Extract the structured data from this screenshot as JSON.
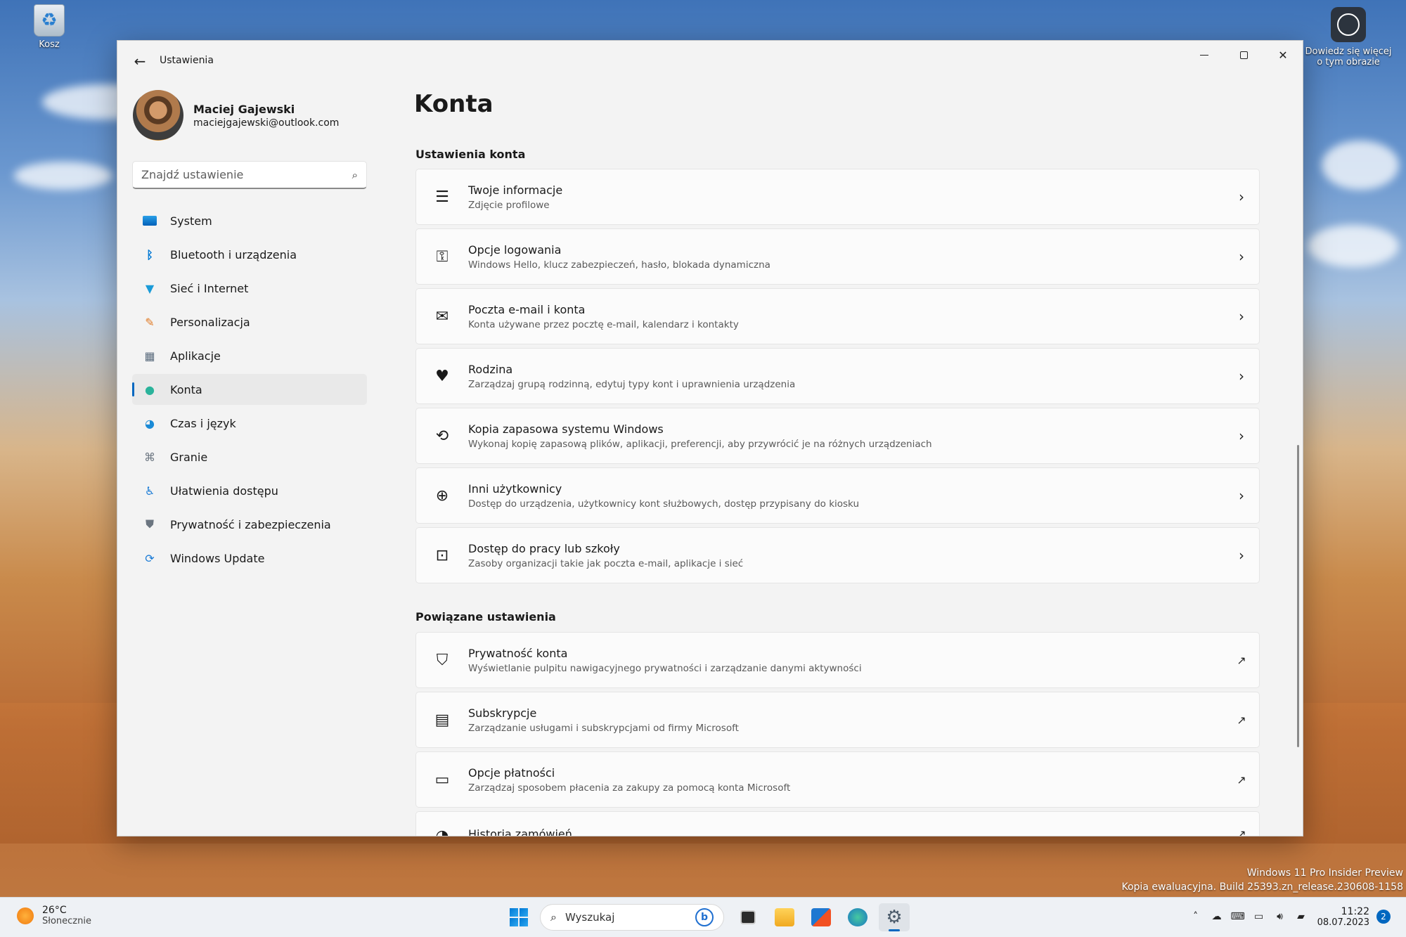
{
  "desktop": {
    "recycle_label": "Kosz",
    "learn_label_line1": "Dowiedz się więcej",
    "learn_label_line2": "o tym obrazie",
    "watermark_line1": "Windows 11 Pro Insider Preview",
    "watermark_line2": "Kopia ewaluacyjna. Build 25393.zn_release.230608-1158"
  },
  "window": {
    "app_title": "Ustawienia",
    "profile": {
      "name": "Maciej Gajewski",
      "email": "maciejgajewski@outlook.com"
    },
    "search": {
      "placeholder": "Znajdź ustawienie"
    },
    "nav": [
      {
        "label": "System",
        "icon": "monitor-icon",
        "color": "#0078d4"
      },
      {
        "label": "Bluetooth i urządzenia",
        "icon": "bluetooth-icon",
        "color": "#0078d4"
      },
      {
        "label": "Sieć i Internet",
        "icon": "wifi-icon",
        "color": "#1a9bd8"
      },
      {
        "label": "Personalizacja",
        "icon": "brush-icon",
        "color": "#e07b26"
      },
      {
        "label": "Aplikacje",
        "icon": "apps-icon",
        "color": "#5a6b7d"
      },
      {
        "label": "Konta",
        "icon": "person-icon",
        "color": "#2bb39b",
        "active": true
      },
      {
        "label": "Czas i język",
        "icon": "globe-clock-icon",
        "color": "#1a8ad6"
      },
      {
        "label": "Granie",
        "icon": "gamepad-icon",
        "color": "#6b7580"
      },
      {
        "label": "Ułatwienia dostępu",
        "icon": "accessibility-icon",
        "color": "#1a7bd6"
      },
      {
        "label": "Prywatność i zabezpieczenia",
        "icon": "shield-icon",
        "color": "#6b7580"
      },
      {
        "label": "Windows Update",
        "icon": "refresh-icon",
        "color": "#1a7bd6"
      }
    ],
    "page_title": "Konta",
    "section_account": "Ustawienia konta",
    "account_cards": [
      {
        "title": "Twoje informacje",
        "sub": "Zdjęcie profilowe",
        "icon": "person-list-icon"
      },
      {
        "title": "Opcje logowania",
        "sub": "Windows Hello, klucz zabezpieczeń, hasło, blokada dynamiczna",
        "icon": "key-icon"
      },
      {
        "title": "Poczta e-mail i konta",
        "sub": "Konta używane przez pocztę e-mail, kalendarz i kontakty",
        "icon": "mail-icon"
      },
      {
        "title": "Rodzina",
        "sub": "Zarządzaj grupą rodzinną, edytuj typy kont i uprawnienia urządzenia",
        "icon": "family-heart-icon"
      },
      {
        "title": "Kopia zapasowa systemu Windows",
        "sub": "Wykonaj kopię zapasową plików, aplikacji, preferencji, aby przywrócić je na różnych urządzeniach",
        "icon": "backup-icon"
      },
      {
        "title": "Inni użytkownicy",
        "sub": "Dostęp do urządzenia, użytkownicy kont służbowych, dostęp przypisany do kiosku",
        "icon": "add-user-icon"
      },
      {
        "title": "Dostęp do pracy lub szkoły",
        "sub": "Zasoby organizacji takie jak poczta e-mail, aplikacje i sieć",
        "icon": "briefcase-icon"
      }
    ],
    "section_related": "Powiązane ustawienia",
    "related_cards": [
      {
        "title": "Prywatność konta",
        "sub": "Wyświetlanie pulpitu nawigacyjnego prywatności i zarządzanie danymi aktywności",
        "icon": "shield-outline-icon"
      },
      {
        "title": "Subskrypcje",
        "sub": "Zarządzanie usługami i subskrypcjami od firmy Microsoft",
        "icon": "subscription-icon"
      },
      {
        "title": "Opcje płatności",
        "sub": "Zarządzaj sposobem płacenia za zakupy za pomocą konta Microsoft",
        "icon": "credit-card-icon"
      },
      {
        "title": "Historia zamówień",
        "sub": "",
        "icon": "history-icon"
      }
    ]
  },
  "taskbar": {
    "weather_temp": "26°C",
    "weather_cond": "Słonecznie",
    "search_placeholder": "Wyszukaj",
    "time": "11:22",
    "date": "08.07.2023",
    "notifications": "2"
  }
}
